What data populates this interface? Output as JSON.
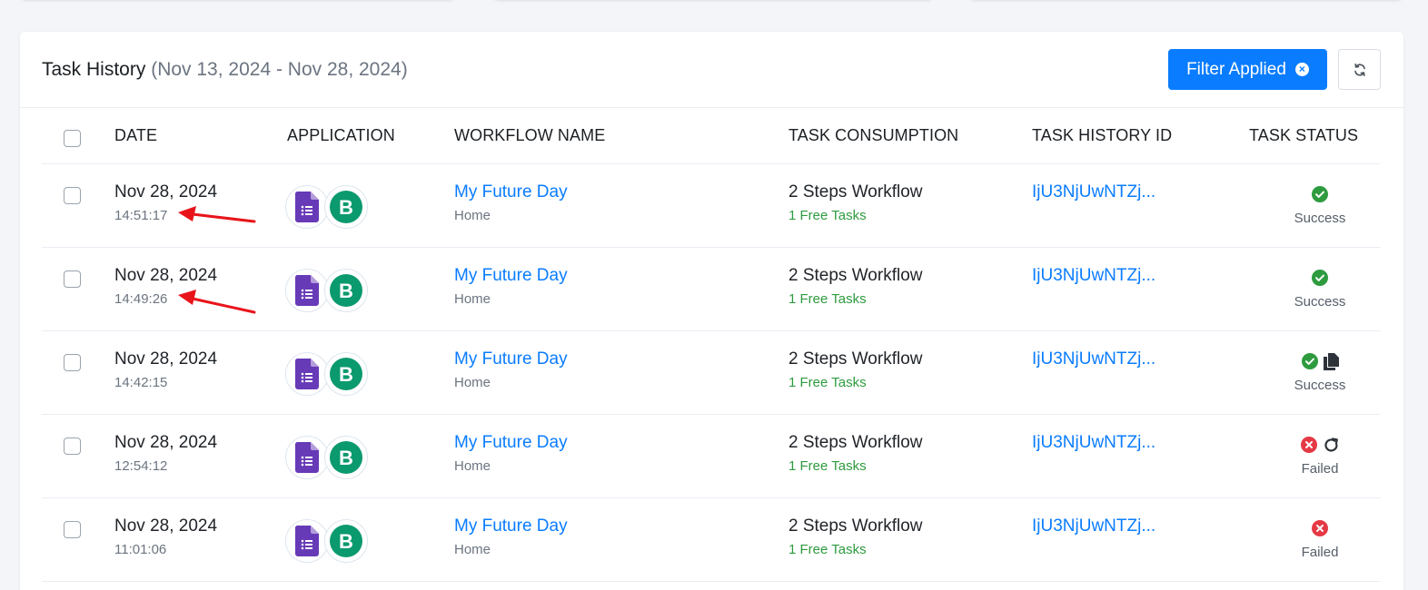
{
  "header": {
    "title": "Task History",
    "date_range": "(Nov 13, 2024 - Nov 28, 2024)",
    "filter_button": "Filter Applied"
  },
  "columns": [
    "DATE",
    "APPLICATION",
    "WORKFLOW NAME",
    "TASK CONSUMPTION",
    "TASK HISTORY ID",
    "TASK STATUS"
  ],
  "rows": [
    {
      "date": "Nov 28, 2024",
      "time": "14:51:17",
      "workflow": "My Future Day",
      "folder": "Home",
      "consumption": "2 Steps Workflow",
      "tasks": "1 Free Tasks",
      "id": "IjU3NjUwNTZj...",
      "status": "Success",
      "status_icons": [
        "check-circle-icon"
      ]
    },
    {
      "date": "Nov 28, 2024",
      "time": "14:49:26",
      "workflow": "My Future Day",
      "folder": "Home",
      "consumption": "2 Steps Workflow",
      "tasks": "1 Free Tasks",
      "id": "IjU3NjUwNTZj...",
      "status": "Success",
      "status_icons": [
        "check-circle-icon"
      ]
    },
    {
      "date": "Nov 28, 2024",
      "time": "14:42:15",
      "workflow": "My Future Day",
      "folder": "Home",
      "consumption": "2 Steps Workflow",
      "tasks": "1 Free Tasks",
      "id": "IjU3NjUwNTZj...",
      "status": "Success",
      "status_icons": [
        "check-circle-icon",
        "copy-icon"
      ]
    },
    {
      "date": "Nov 28, 2024",
      "time": "12:54:12",
      "workflow": "My Future Day",
      "folder": "Home",
      "consumption": "2 Steps Workflow",
      "tasks": "1 Free Tasks",
      "id": "IjU3NjUwNTZj...",
      "status": "Failed",
      "status_icons": [
        "x-circle-icon",
        "retry-icon"
      ]
    },
    {
      "date": "Nov 28, 2024",
      "time": "11:01:06",
      "workflow": "My Future Day",
      "folder": "Home",
      "consumption": "2 Steps Workflow",
      "tasks": "1 Free Tasks",
      "id": "IjU3NjUwNTZj...",
      "status": "Failed",
      "status_icons": [
        "x-circle-icon"
      ]
    }
  ],
  "app_icons": [
    "google-forms-icon",
    "brevo-icon"
  ],
  "colors": {
    "accent": "#0a7cff",
    "success": "#2e9b3f",
    "failed": "#e53945",
    "forms_purple": "#673ab7",
    "brevo_green": "#0b996e",
    "annotation_arrow": "#e8141a"
  }
}
